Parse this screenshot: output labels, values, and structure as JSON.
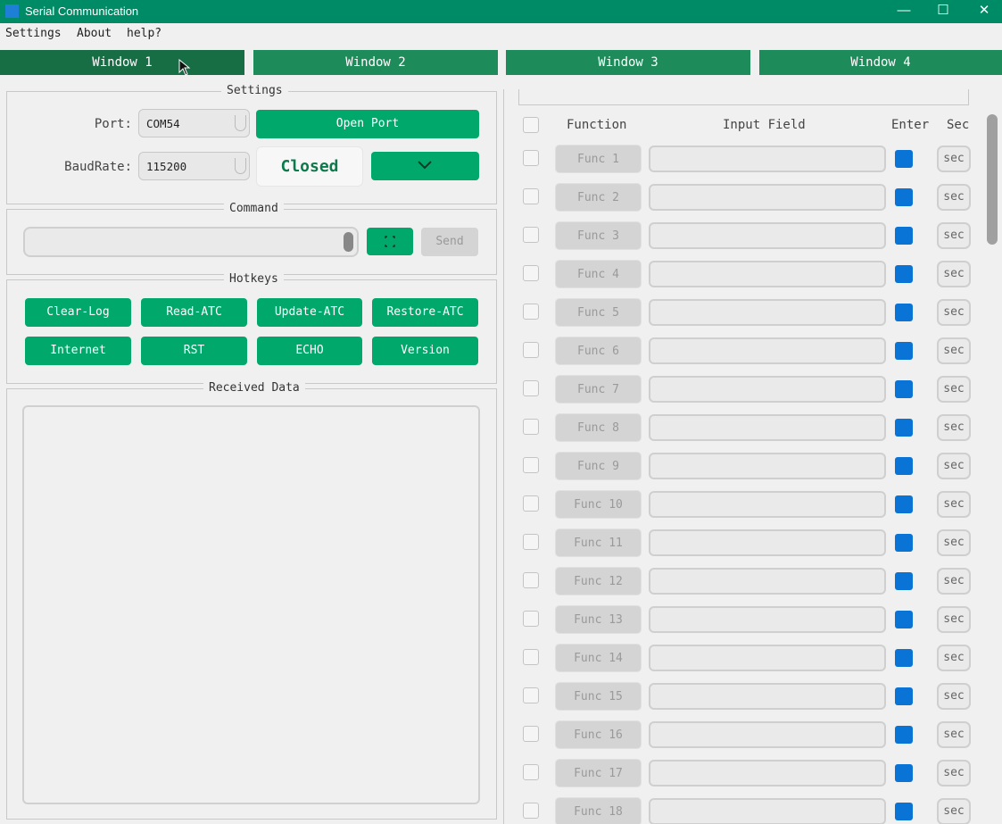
{
  "window": {
    "title": "Serial Communication",
    "minimize": "—",
    "maximize": "☐",
    "close": "✕"
  },
  "menu": [
    "Settings",
    "About",
    "help?"
  ],
  "tabs": [
    "Window 1",
    "Window 2",
    "Window 3",
    "Window 4"
  ],
  "settings": {
    "title": "Settings",
    "port_label": "Port:",
    "port_value": "COM54",
    "baud_label": "BaudRate:",
    "baud_value": "115200",
    "open_port": "Open Port",
    "status": "Closed",
    "dropdown_icon": "chevron-down"
  },
  "command": {
    "title": "Command",
    "expand_icon": "expand",
    "send": "Send"
  },
  "hotkeys": {
    "title": "Hotkeys",
    "buttons": [
      "Clear-Log",
      "Read-ATC",
      "Update-ATC",
      "Restore-ATC",
      "Internet",
      "RST",
      "ECHO",
      "Version"
    ]
  },
  "received": {
    "title": "Received Data"
  },
  "functions": {
    "headers": {
      "function": "Function",
      "input": "Input Field",
      "enter": "Enter",
      "sec": "Sec"
    },
    "rows": [
      {
        "name": "Func 1",
        "sec": "sec"
      },
      {
        "name": "Func 2",
        "sec": "sec"
      },
      {
        "name": "Func 3",
        "sec": "sec"
      },
      {
        "name": "Func 4",
        "sec": "sec"
      },
      {
        "name": "Func 5",
        "sec": "sec"
      },
      {
        "name": "Func 6",
        "sec": "sec"
      },
      {
        "name": "Func 7",
        "sec": "sec"
      },
      {
        "name": "Func 8",
        "sec": "sec"
      },
      {
        "name": "Func 9",
        "sec": "sec"
      },
      {
        "name": "Func 10",
        "sec": "sec"
      },
      {
        "name": "Func 11",
        "sec": "sec"
      },
      {
        "name": "Func 12",
        "sec": "sec"
      },
      {
        "name": "Func 13",
        "sec": "sec"
      },
      {
        "name": "Func 14",
        "sec": "sec"
      },
      {
        "name": "Func 15",
        "sec": "sec"
      },
      {
        "name": "Func 16",
        "sec": "sec"
      },
      {
        "name": "Func 17",
        "sec": "sec"
      },
      {
        "name": "Func 18",
        "sec": "sec"
      }
    ]
  },
  "colors": {
    "titlebar": "#008b67",
    "tab": "#1e8b5a",
    "tab_active": "#176d44",
    "green_button": "#00a86b",
    "enter_checked": "#0a73d6"
  }
}
